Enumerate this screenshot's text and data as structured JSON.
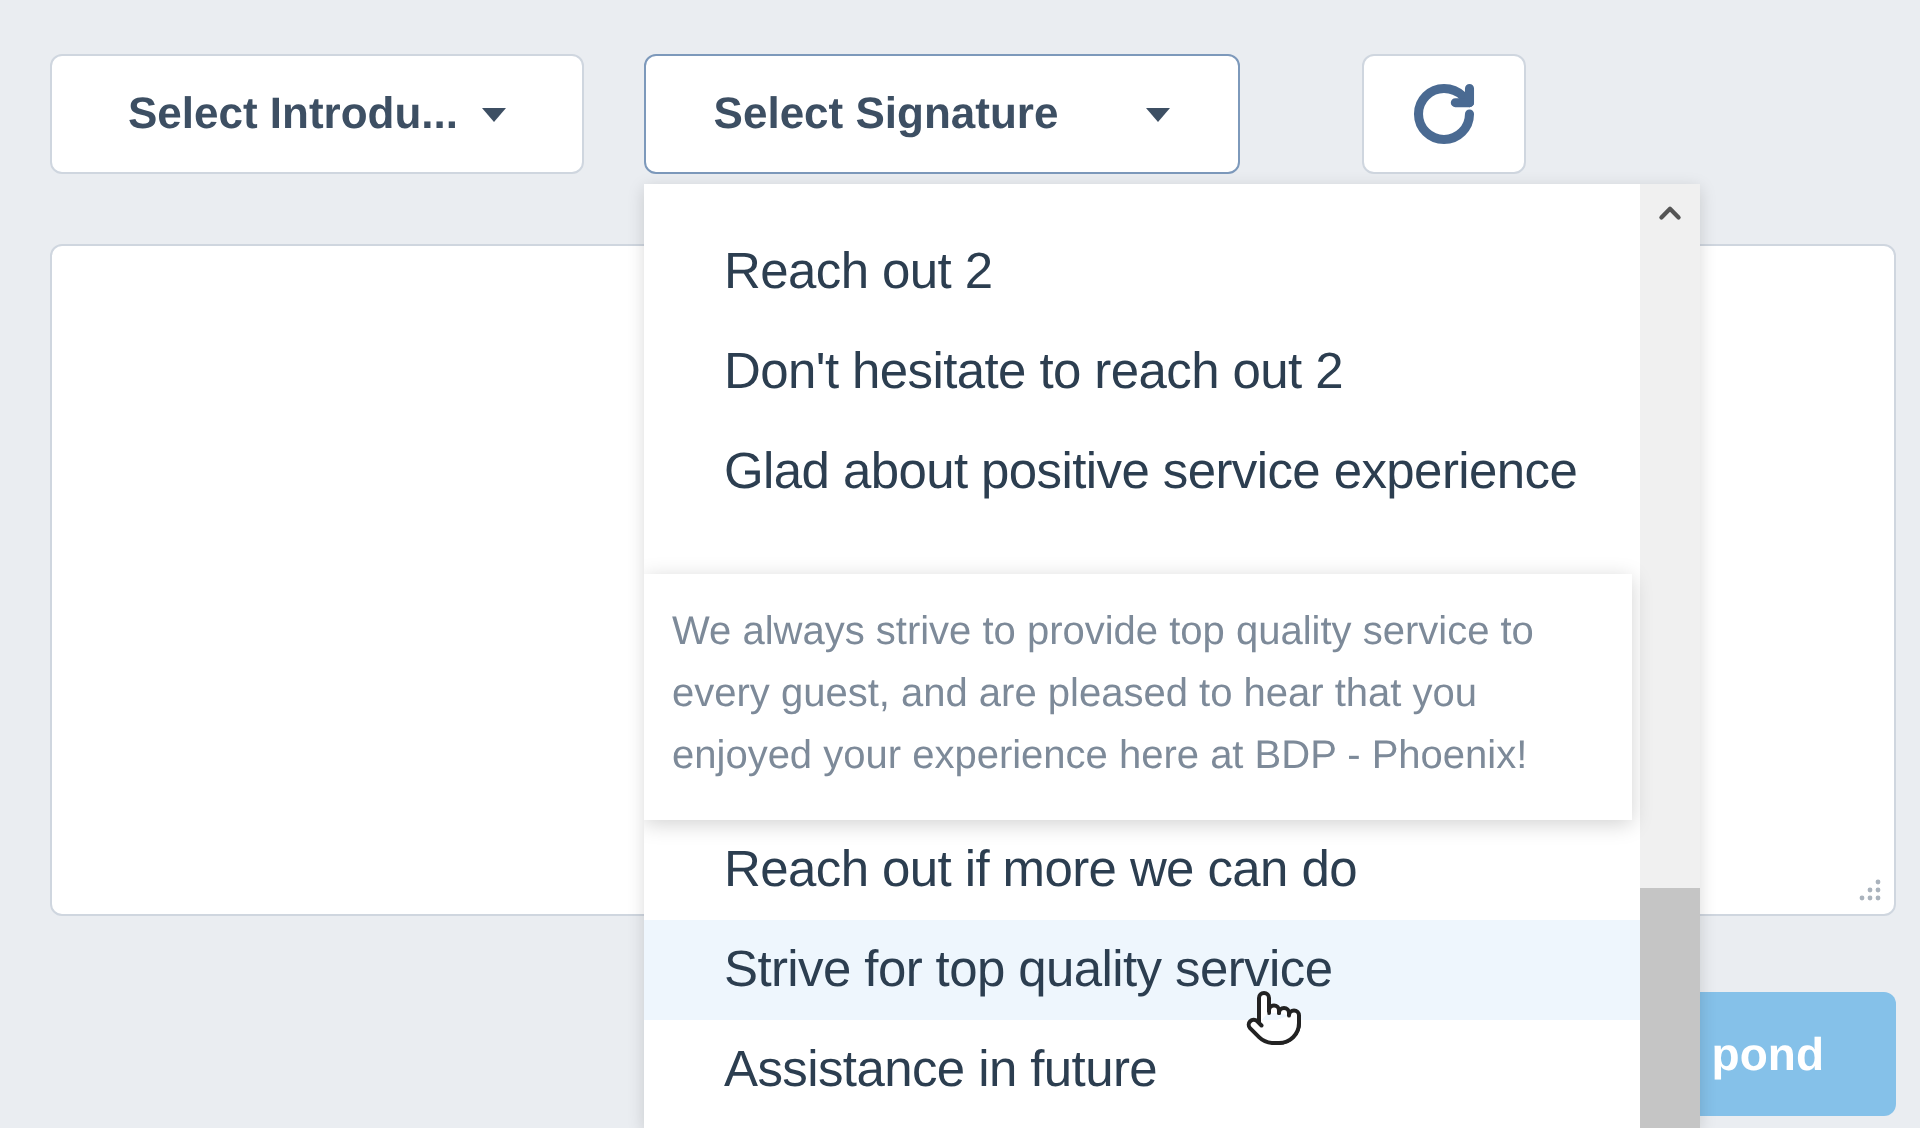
{
  "toolbar": {
    "introduction_select": "Select Introdu...",
    "signature_select": {
      "label": "Select Signature",
      "focused": true
    }
  },
  "signature_menu": {
    "items_above": [
      {
        "label": "Reach out 2",
        "selected": false
      },
      {
        "label": "Don't hesitate to reach out 2",
        "selected": false
      },
      {
        "label": "Glad about positive service experience",
        "selected": false
      }
    ],
    "tooltip": {
      "text": "We always strive to provide top quality service to every guest, and are pleased to hear that you enjoyed your experience here at BDP - Phoenix!"
    },
    "items_below": [
      {
        "label": "Reach out if more we can do",
        "selected": false
      },
      {
        "label": "Strive for top quality service",
        "selected": true
      },
      {
        "label": "Assistance in future",
        "selected": false
      }
    ]
  },
  "respond_button": "pond"
}
